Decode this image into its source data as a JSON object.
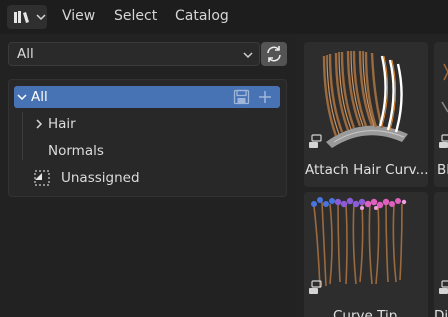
{
  "header": {
    "editor_type_icon": "asset-browser-icon",
    "menus": [
      "View",
      "Select",
      "Catalog"
    ]
  },
  "sidebar": {
    "catalog_select": {
      "value": "All",
      "icon": "chevron-down-icon"
    },
    "refresh_icon": "refresh-icon",
    "tree": {
      "root": {
        "label": "All",
        "expanded": true,
        "selected": true
      },
      "children": [
        {
          "label": "Hair",
          "has_children": true
        },
        {
          "label": "Normals",
          "has_children": false
        }
      ],
      "unassigned": {
        "label": "Unassigned",
        "icon": "unassigned-icon"
      }
    }
  },
  "assets": [
    {
      "label": "Attach Hair Curv...",
      "type_icon": "node-group-icon",
      "thumbnail": "hair-strands-attached"
    },
    {
      "label": "Bl",
      "type_icon": "node-group-icon",
      "thumbnail": "partial"
    },
    {
      "label": "Curve Tip",
      "type_icon": "node-group-icon",
      "thumbnail": "hair-strands-curve-tip"
    },
    {
      "label": "Di",
      "type_icon": "node-group-icon",
      "thumbnail": "partial"
    }
  ],
  "colors": {
    "accent": "#4772b3",
    "hair_brown": "#9b6a3e",
    "tip_purple": "#8a5cd6",
    "tip_pink": "#e060c0",
    "tip_blue": "#4a74e0"
  }
}
